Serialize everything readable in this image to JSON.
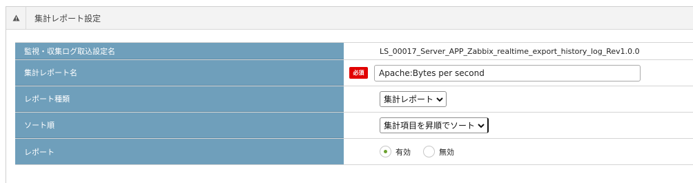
{
  "panel": {
    "title": "集計レポート設定",
    "icon": "warning-triangle-icon"
  },
  "form": {
    "monitor_setting": {
      "label": "監視・収集ログ取込設定名",
      "value": "LS_00017_Server_APP_Zabbix_realtime_export_history_log_Rev1.0.0"
    },
    "report_name": {
      "label": "集計レポート名",
      "required_badge": "必須",
      "value": "Apache:Bytes per second"
    },
    "report_type": {
      "label": "レポート種類",
      "selected": "集計レポート"
    },
    "sort_order": {
      "label": "ソート順",
      "selected": "集計項目を昇順でソート"
    },
    "report_enabled": {
      "label": "レポート",
      "options": [
        "有効",
        "無効"
      ],
      "selected": "有効",
      "accent_color": "#6ba12f"
    }
  },
  "colors": {
    "label_bg": "#6f9fbb",
    "required_badge": "#e10000"
  }
}
